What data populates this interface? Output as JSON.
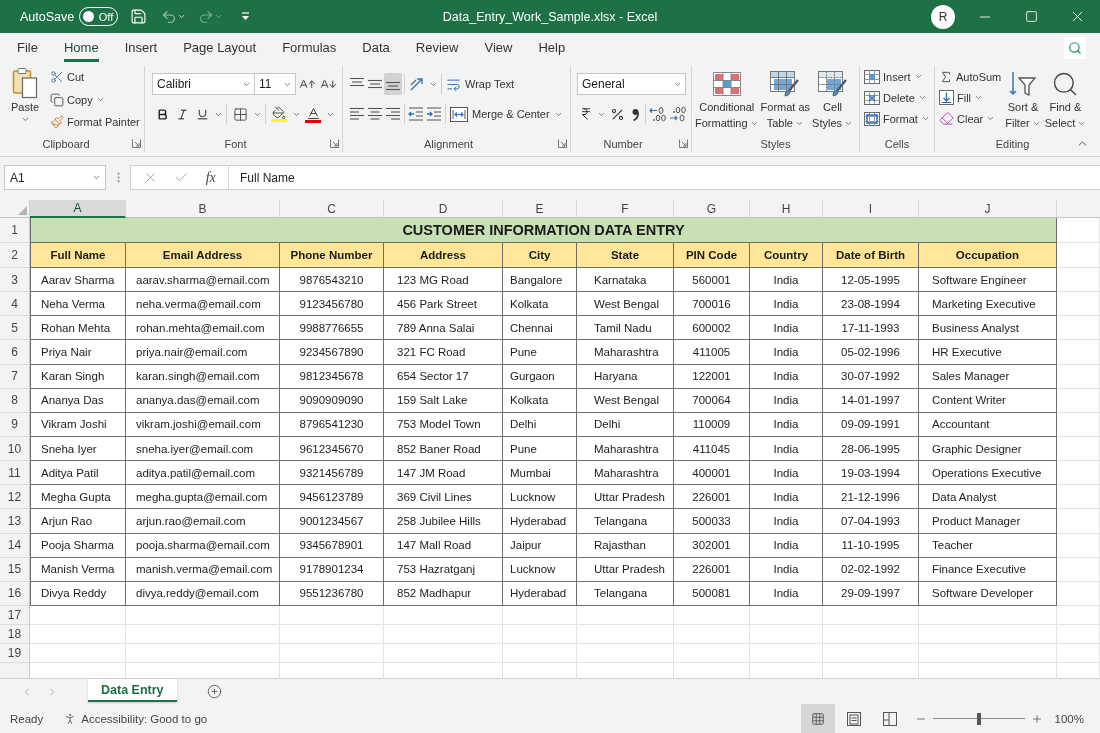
{
  "window": {
    "autosave": {
      "label": "AutoSave",
      "on": false,
      "state_label": "Off"
    },
    "title": "Data_Entry_Work_Sample.xlsx - Excel",
    "account_initial": "R"
  },
  "ribbon": {
    "tabs": [
      {
        "label": "File",
        "selected": false
      },
      {
        "label": "Home",
        "selected": true
      },
      {
        "label": "Insert",
        "selected": false
      },
      {
        "label": "Page Layout",
        "selected": false
      },
      {
        "label": "Formulas",
        "selected": false
      },
      {
        "label": "Data",
        "selected": false
      },
      {
        "label": "Review",
        "selected": false
      },
      {
        "label": "View",
        "selected": false
      },
      {
        "label": "Help",
        "selected": false
      }
    ],
    "groups": [
      {
        "kind": "clipboard",
        "label": "Clipboard",
        "launcher": true,
        "paste": "Paste",
        "items": [
          {
            "label": "Cut",
            "menu": false
          },
          {
            "label": "Copy",
            "menu": true
          },
          {
            "label": "Format Painter",
            "menu": false
          }
        ]
      },
      {
        "kind": "font",
        "label": "Font",
        "launcher": true,
        "font_name": "Calibri",
        "font_size": "11"
      },
      {
        "kind": "alignment",
        "label": "Alignment",
        "launcher": true,
        "vertical_align": [
          {
            "selected": false
          },
          {
            "selected": false
          },
          {
            "selected": true
          }
        ],
        "wrap_text": "Wrap Text",
        "merge": "Merge & Center"
      },
      {
        "kind": "number",
        "label": "Number",
        "launcher": true,
        "format": "General"
      },
      {
        "kind": "styles",
        "label": "Styles",
        "launcher": false,
        "items": [
          {
            "lines": [
              "Conditional",
              "Formatting"
            ],
            "menu": true
          },
          {
            "lines": [
              "Format as",
              "Table"
            ],
            "menu": true
          },
          {
            "lines": [
              "Cell",
              "Styles"
            ],
            "menu": true
          }
        ]
      },
      {
        "kind": "cells",
        "label": "Cells",
        "launcher": false,
        "items": [
          {
            "label": "Insert",
            "menu": true
          },
          {
            "label": "Delete",
            "menu": true
          },
          {
            "label": "Format",
            "menu": true
          }
        ]
      },
      {
        "kind": "editing",
        "label": "Editing",
        "launcher": false,
        "items": [
          {
            "label": "AutoSum",
            "menu": false
          },
          {
            "label": "Fill",
            "menu": true
          },
          {
            "label": "Clear",
            "menu": true
          }
        ],
        "big": [
          {
            "lines": [
              "Sort &",
              "Filter"
            ],
            "menu": true
          },
          {
            "lines": [
              "Find &",
              "Select"
            ],
            "menu": true
          }
        ]
      }
    ]
  },
  "formula_bar": {
    "name_box": "A1",
    "function_label": "fx",
    "content": "Full Name"
  },
  "sheet": {
    "columns": [
      {
        "letter": "A",
        "selected": true
      },
      {
        "letter": "B",
        "selected": false
      },
      {
        "letter": "C",
        "selected": false
      },
      {
        "letter": "D",
        "selected": false
      },
      {
        "letter": "E",
        "selected": false
      },
      {
        "letter": "F",
        "selected": false
      },
      {
        "letter": "G",
        "selected": false
      },
      {
        "letter": "H",
        "selected": false
      },
      {
        "letter": "I",
        "selected": false
      },
      {
        "letter": "J",
        "selected": false
      }
    ],
    "row_numbers": [
      "1",
      "2",
      "3",
      "4",
      "5",
      "6",
      "7",
      "8",
      "9",
      "10",
      "11",
      "12",
      "13",
      "14",
      "15",
      "16",
      "17",
      "18",
      "19"
    ],
    "title": "CUSTOMER INFORMATION DATA ENTRY",
    "headers": [
      "Full Name",
      "Email Address",
      "Phone Number",
      "Address",
      "City",
      "State",
      "PIN Code",
      "Country",
      "Date of Birth",
      "Occupation"
    ],
    "rows": [
      [
        "Aarav Sharma",
        "aarav.sharma@email.com",
        "9876543210",
        "123 MG Road",
        "Bangalore",
        "Karnataka",
        "560001",
        "India",
        "12-05-1995",
        "Software Engineer"
      ],
      [
        "Neha Verma",
        "neha.verma@email.com",
        "9123456780",
        "456 Park Street",
        "Kolkata",
        "West Bengal",
        "700016",
        "India",
        "23-08-1994",
        "Marketing Executive"
      ],
      [
        "Rohan Mehta",
        "rohan.mehta@email.com",
        "9988776655",
        "789 Anna Salai",
        "Chennai",
        "Tamil Nadu",
        "600002",
        "India",
        "17-11-1993",
        "Business Analyst"
      ],
      [
        "Priya Nair",
        "priya.nair@email.com",
        "9234567890",
        "321 FC Road",
        "Pune",
        "Maharashtra",
        "411005",
        "India",
        "05-02-1996",
        "HR Executive"
      ],
      [
        "Karan Singh",
        "karan.singh@email.com",
        "9812345678",
        "654 Sector 17",
        "Gurgaon",
        "Haryana",
        "122001",
        "India",
        "30-07-1992",
        "Sales Manager"
      ],
      [
        "Ananya Das",
        "ananya.das@email.com",
        "9090909090",
        "159 Salt Lake",
        "Kolkata",
        "West Bengal",
        "700064",
        "India",
        "14-01-1997",
        "Content Writer"
      ],
      [
        "Vikram Joshi",
        "vikram.joshi@email.com",
        "8796541230",
        "753 Model Town",
        "Delhi",
        "Delhi",
        "110009",
        "India",
        "09-09-1991",
        "Accountant"
      ],
      [
        "Sneha Iyer",
        "sneha.iyer@email.com",
        "9612345670",
        "852 Baner Road",
        "Pune",
        "Maharashtra",
        "411045",
        "India",
        "28-06-1995",
        "Graphic Designer"
      ],
      [
        "Aditya Patil",
        "aditya.patil@email.com",
        "9321456789",
        "147 JM Road",
        "Mumbai",
        "Maharashtra",
        "400001",
        "India",
        "19-03-1994",
        "Operations Executive"
      ],
      [
        "Megha Gupta",
        "megha.gupta@email.com",
        "9456123789",
        "369 Civil Lines",
        "Lucknow",
        "Uttar Pradesh",
        "226001",
        "India",
        "21-12-1996",
        "Data Analyst"
      ],
      [
        "Arjun Rao",
        "arjun.rao@email.com",
        "9001234567",
        "258 Jubilee Hills",
        "Hyderabad",
        "Telangana",
        "500033",
        "India",
        "07-04-1993",
        "Product Manager"
      ],
      [
        "Pooja Sharma",
        "pooja.sharma@email.com",
        "9345678901",
        "147 Mall Road",
        "Jaipur",
        "Rajasthan",
        "302001",
        "India",
        "11-10-1995",
        "Teacher"
      ],
      [
        "Manish Verma",
        "manish.verma@email.com",
        "9178901234",
        "753 Hazratganj",
        "Lucknow",
        "Uttar Pradesh",
        "226001",
        "India",
        "02-02-1992",
        "Finance Executive"
      ],
      [
        "Divya Reddy",
        "divya.reddy@email.com",
        "9551236780",
        "852 Madhapur",
        "Hyderabad",
        "Telangana",
        "500081",
        "India",
        "29-09-1997",
        "Software Developer"
      ]
    ]
  },
  "sheet_tabs": [
    {
      "label": "Data Entry",
      "selected": true
    }
  ],
  "status_bar": {
    "mode": "Ready",
    "accessibility": "Accessibility: Good to go",
    "views": [
      {
        "kind": "normal",
        "selected": true
      },
      {
        "kind": "page_layout",
        "selected": false
      },
      {
        "kind": "page_break",
        "selected": false
      }
    ],
    "zoom": {
      "level": 0.5,
      "reading": "100%"
    }
  }
}
